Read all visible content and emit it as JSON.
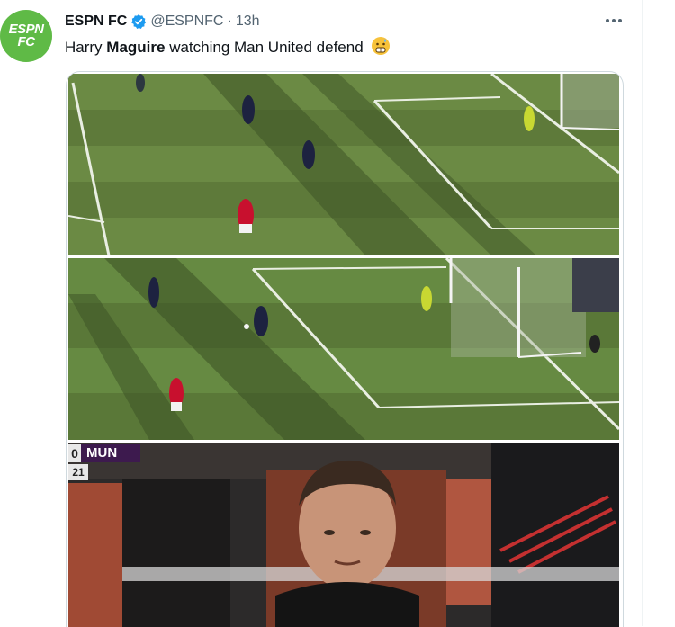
{
  "tweet": {
    "author_name": "ESPN FC",
    "handle": "@ESPNFC",
    "separator": "·",
    "time": "13h",
    "text_before": "Harry ",
    "text_bold": "Maguire",
    "text_after": " watching Man United defend",
    "emoji": "face-with-open-mouth-and-cold-sweat emoji",
    "avatar_line1": "ESPN",
    "avatar_line2": "FC"
  },
  "icons": {
    "verified": "verified-badge-icon",
    "more": "more-options-icon"
  },
  "media": {
    "scoreboard": {
      "home_score": "0",
      "team": "MUN",
      "minute": "21"
    }
  },
  "colors": {
    "avatar": "#5fba46",
    "verified": "#1d9bf0",
    "pitch": "#5f7a3c",
    "scoreboard_team": "#3d1a4e"
  }
}
